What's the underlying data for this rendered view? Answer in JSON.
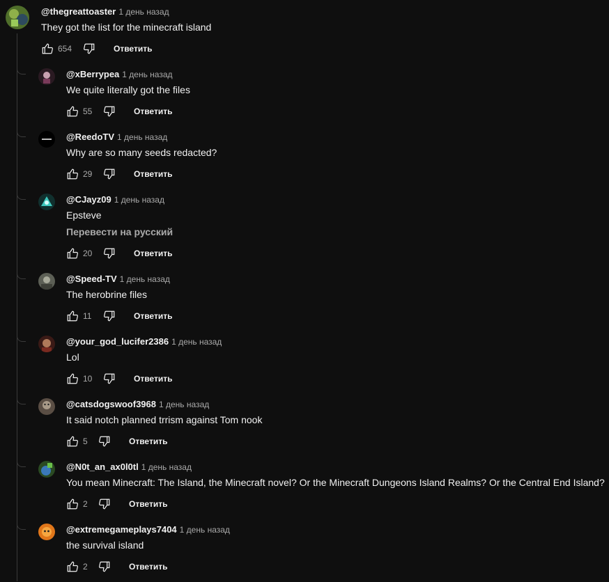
{
  "main_comment": {
    "author": "@thegreattoaster",
    "time": "1 день назад",
    "text": "They got the list for the minecraft island",
    "likes": "654",
    "reply_label": "Ответить",
    "avatar_color": "#5a7a2a"
  },
  "replies": [
    {
      "author": "@xBerrypea",
      "time": "1 день назад",
      "text": "We quite literally got the files",
      "likes": "55",
      "reply_label": "Ответить",
      "avatar_color": "#3a2230"
    },
    {
      "author": "@ReedoTV",
      "time": "1 день назад",
      "text": "Why are so many seeds redacted?",
      "likes": "29",
      "reply_label": "Ответить",
      "avatar_color": "#000000",
      "avatar_text": "reedo tv"
    },
    {
      "author": "@CJayz09",
      "time": "1 день назад",
      "text": "Epsteve",
      "translate": "Перевести на русский",
      "likes": "20",
      "reply_label": "Ответить",
      "avatar_color": "#2aa7a0"
    },
    {
      "author": "@Speed-TV",
      "time": "1 день назад",
      "text": "The herobrine files",
      "likes": "11",
      "reply_label": "Ответить",
      "avatar_color": "#6b6e62"
    },
    {
      "author": "@your_god_lucifer2386",
      "time": "1 день назад",
      "text": "Lol",
      "likes": "10",
      "reply_label": "Ответить",
      "avatar_color": "#6a2a22"
    },
    {
      "author": "@catsdogswoof3968",
      "time": "1 день назад",
      "text": "It said notch planned trrism against Tom nook",
      "likes": "5",
      "reply_label": "Ответить",
      "avatar_color": "#7a6a5a"
    },
    {
      "author": "@N0t_an_ax0l0tl",
      "time": "1 день назад",
      "text": "You mean Minecraft: The Island, the Minecraft novel? Or the Minecraft Dungeons Island Realms? Or the Central End Island?",
      "likes": "2",
      "reply_label": "Ответить",
      "avatar_color": "#3a6a8a"
    },
    {
      "author": "@extremegameplays7404",
      "time": "1 день назад",
      "text": "the survival island",
      "likes": "2",
      "reply_label": "Ответить",
      "avatar_color": "#e0761a"
    }
  ]
}
